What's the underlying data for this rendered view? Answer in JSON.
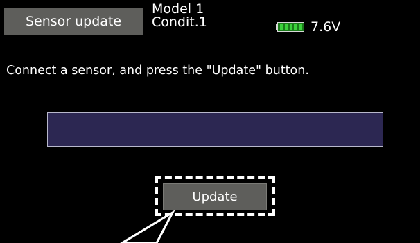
{
  "header": {
    "screen_title": "Sensor update",
    "model_name": "Model 1",
    "condition": "Condit.1",
    "battery": {
      "voltage": "7.6V",
      "level": 1.0,
      "color": "#3bd13b"
    }
  },
  "main": {
    "instruction": "Connect a sensor, and press the \"Update\" button.",
    "progress": {
      "value": 0,
      "bar_color": "#2c2752"
    },
    "update_button": {
      "label": "Update"
    }
  },
  "colors": {
    "background": "#000000",
    "title_tab": "#5e5e5b",
    "button": "#5e5e5b",
    "focus_frame": "#ffffff"
  }
}
